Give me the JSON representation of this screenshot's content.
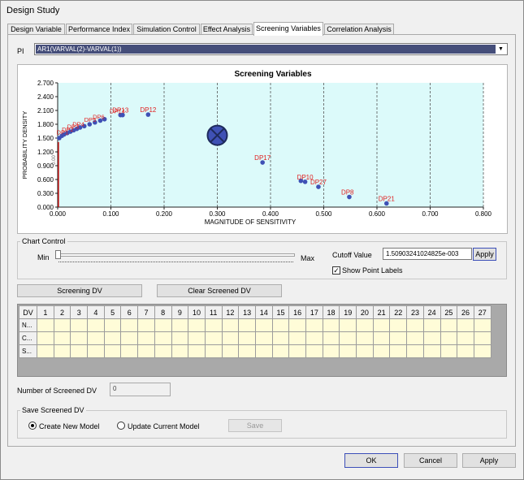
{
  "window": {
    "title": "Design Study"
  },
  "tabs": [
    {
      "label": "Design Variable"
    },
    {
      "label": "Performance Index"
    },
    {
      "label": "Simulation Control"
    },
    {
      "label": "Effect Analysis"
    },
    {
      "label": "Screening Variables"
    },
    {
      "label": "Correlation Analysis"
    }
  ],
  "active_tab": "Screening Variables",
  "pi": {
    "label": "PI",
    "value": "AR1(VARVAL(2)-VARVAL(1))"
  },
  "chart_data": {
    "type": "scatter",
    "title": "Screening Variables",
    "xlabel": "MAGNITUDE OF SENSITIVITY",
    "ylabel": "PROBABILITY DENSITY",
    "xlim": [
      0,
      0.8
    ],
    "ylim": [
      0,
      2.7
    ],
    "xticks": [
      "0.000",
      "0.100",
      "0.200",
      "0.300",
      "0.400",
      "0.500",
      "0.600",
      "0.700",
      "0.800"
    ],
    "yticks": [
      "0.000",
      "0.300",
      "0.600",
      "0.900",
      "1.200",
      "1.500",
      "1.800",
      "2.100",
      "2.400",
      "2.700"
    ],
    "grid": "vertical dashed",
    "cutoff_marker_label": "0.00",
    "marker_value": {
      "x": 0.3,
      "y": 1.56
    },
    "points": [
      {
        "x": 0.003,
        "y": 1.5,
        "label": ""
      },
      {
        "x": 0.008,
        "y": 1.55,
        "label": ""
      },
      {
        "x": 0.012,
        "y": 1.58,
        "label": ""
      },
      {
        "x": 0.018,
        "y": 1.61,
        "label": ""
      },
      {
        "x": 0.024,
        "y": 1.64,
        "label": ""
      },
      {
        "x": 0.03,
        "y": 1.67,
        "label": ""
      },
      {
        "x": 0.036,
        "y": 1.7,
        "label": ""
      },
      {
        "x": 0.042,
        "y": 1.73,
        "label": ""
      },
      {
        "x": 0.05,
        "y": 1.76,
        "label": ""
      },
      {
        "x": 0.06,
        "y": 1.8,
        "label": ""
      },
      {
        "x": 0.07,
        "y": 1.84,
        "label": ""
      },
      {
        "x": 0.08,
        "y": 1.88,
        "label": ""
      },
      {
        "x": 0.088,
        "y": 1.91,
        "label": ""
      },
      {
        "x": 0.118,
        "y": 2.0,
        "label": "DP13"
      },
      {
        "x": 0.122,
        "y": 2.0,
        "label": ""
      },
      {
        "x": 0.17,
        "y": 2.01,
        "label": "DP12"
      },
      {
        "x": 0.385,
        "y": 0.97,
        "label": "DP17"
      },
      {
        "x": 0.457,
        "y": 0.57,
        "label": ""
      },
      {
        "x": 0.465,
        "y": 0.55,
        "label": "DP10"
      },
      {
        "x": 0.49,
        "y": 0.44,
        "label": "DP27"
      },
      {
        "x": 0.548,
        "y": 0.22,
        "label": "DP8"
      },
      {
        "x": 0.618,
        "y": 0.08,
        "label": "DP21"
      }
    ],
    "dense_labels": [
      {
        "x": 0.01,
        "y": 1.6,
        "label": "DP1"
      },
      {
        "x": 0.02,
        "y": 1.66,
        "label": "DP2"
      },
      {
        "x": 0.03,
        "y": 1.72,
        "label": "DP3"
      },
      {
        "x": 0.04,
        "y": 1.77,
        "label": "DP4"
      },
      {
        "x": 0.062,
        "y": 1.87,
        "label": "DP5"
      },
      {
        "x": 0.078,
        "y": 1.93,
        "label": "DP6"
      },
      {
        "x": 0.11,
        "y": 2.06,
        "label": "DP14"
      }
    ]
  },
  "chart_control": {
    "group_title": "Chart Control",
    "min_label": "Min",
    "max_label": "Max",
    "slider_fraction": 0.0,
    "cutoff_label": "Cutoff Value",
    "cutoff_value": "1.50903241024825e-003",
    "apply_label": "Apply",
    "show_labels_label": "Show Point Labels",
    "show_labels_checked": true
  },
  "buttons": {
    "screening_dv": "Screening DV",
    "clear_screened_dv": "Clear Screened DV"
  },
  "grid": {
    "columns": [
      "DV",
      "1",
      "2",
      "3",
      "4",
      "5",
      "6",
      "7",
      "8",
      "9",
      "10",
      "11",
      "12",
      "13",
      "14",
      "15",
      "16",
      "17",
      "18",
      "19",
      "20",
      "21",
      "22",
      "23",
      "24",
      "25",
      "26",
      "27"
    ],
    "rows": [
      "N...",
      "C...",
      "S..."
    ]
  },
  "screened_count": {
    "label": "Number of Screened DV",
    "value": "0"
  },
  "save_group": {
    "title": "Save Screened DV",
    "create_label": "Create New Model",
    "update_label": "Update Current Model",
    "selected": "create",
    "save_label": "Save"
  },
  "footer": {
    "ok": "OK",
    "cancel": "Cancel",
    "apply": "Apply"
  },
  "colors": {
    "plot_bg": "#dcfafa",
    "point": "#3f51b5",
    "label": "#e02020",
    "cutoff_line": "#e00000",
    "selection": "#454e7a"
  }
}
